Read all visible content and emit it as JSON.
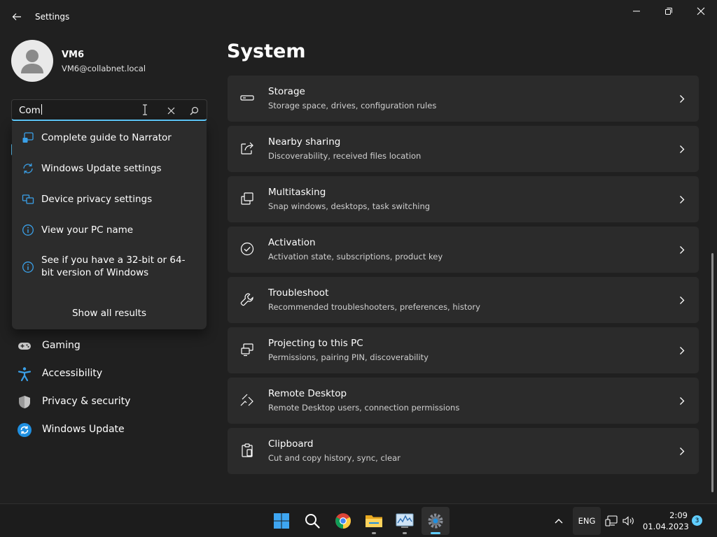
{
  "window": {
    "title": "Settings"
  },
  "profile": {
    "name": "VM6",
    "email": "VM6@collabnet.local"
  },
  "search": {
    "value": "Com"
  },
  "suggestions": [
    {
      "label": "Complete guide to Narrator",
      "icon": "narrator-icon"
    },
    {
      "label": "Windows Update settings",
      "icon": "sync-icon"
    },
    {
      "label": "Device privacy settings",
      "icon": "device-privacy-icon"
    },
    {
      "label": "View your PC name",
      "icon": "info-icon"
    },
    {
      "label": "See if you have a 32-bit or 64-bit version of Windows",
      "icon": "info-icon"
    }
  ],
  "show_all_label": "Show all results",
  "nav": [
    {
      "label": "Gaming",
      "icon": "gamepad-icon"
    },
    {
      "label": "Accessibility",
      "icon": "accessibility-icon"
    },
    {
      "label": "Privacy & security",
      "icon": "shield-icon"
    },
    {
      "label": "Windows Update",
      "icon": "windows-update-icon"
    }
  ],
  "page_title": "System",
  "cards": [
    {
      "title": "Storage",
      "subtitle": "Storage space, drives, configuration rules",
      "icon": "storage-icon"
    },
    {
      "title": "Nearby sharing",
      "subtitle": "Discoverability, received files location",
      "icon": "share-icon"
    },
    {
      "title": "Multitasking",
      "subtitle": "Snap windows, desktops, task switching",
      "icon": "multitasking-icon"
    },
    {
      "title": "Activation",
      "subtitle": "Activation state, subscriptions, product key",
      "icon": "checkmark-circle-icon"
    },
    {
      "title": "Troubleshoot",
      "subtitle": "Recommended troubleshooters, preferences, history",
      "icon": "wrench-icon"
    },
    {
      "title": "Projecting to this PC",
      "subtitle": "Permissions, pairing PIN, discoverability",
      "icon": "projector-icon"
    },
    {
      "title": "Remote Desktop",
      "subtitle": "Remote Desktop users, connection permissions",
      "icon": "remote-desktop-icon"
    },
    {
      "title": "Clipboard",
      "subtitle": "Cut and copy history, sync, clear",
      "icon": "clipboard-icon"
    }
  ],
  "taskbar": {
    "apps": [
      "start-icon",
      "search-icon",
      "chrome-icon",
      "file-explorer-icon",
      "task-manager-icon",
      "settings-icon"
    ],
    "language": "ENG",
    "time": "2:09",
    "date": "01.04.2023",
    "notifications": "3"
  },
  "colors": {
    "accent": "#60cdff",
    "background": "#202020",
    "card": "#2b2b2b",
    "flyout": "#2c2c2c"
  }
}
